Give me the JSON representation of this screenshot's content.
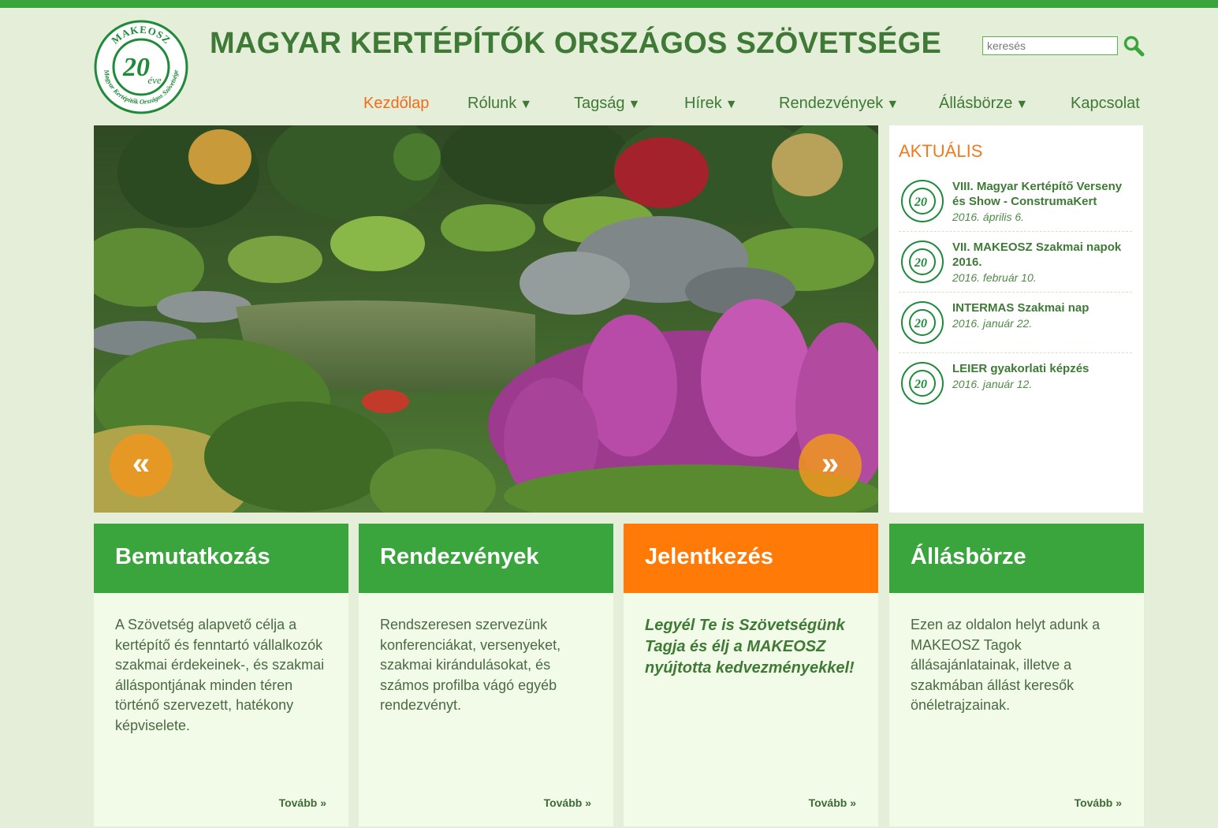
{
  "brand": {
    "logo_text_top": "MAKEOSZ",
    "logo_years": "20",
    "logo_eve": "éve",
    "logo_text_ring": "Magyar Kertépítők Országos Szövetsége",
    "title": "MAGYAR KERTÉPÍTŐK ORSZÁGOS SZÖVETSÉGE"
  },
  "search": {
    "placeholder": "keresés",
    "value": ""
  },
  "nav": {
    "items": [
      {
        "label": "Kezdőlap",
        "arrow": ""
      },
      {
        "label": "Rólunk",
        "arrow": "▼"
      },
      {
        "label": "Tagság",
        "arrow": "▼"
      },
      {
        "label": "Hírek",
        "arrow": "▼"
      },
      {
        "label": "Rendezvények",
        "arrow": "▼"
      },
      {
        "label": "Állásbörze",
        "arrow": "▼"
      },
      {
        "label": "Kapcsolat",
        "arrow": ""
      }
    ]
  },
  "slider": {
    "prev": "«",
    "next": "»"
  },
  "news": {
    "heading": "AKTUÁLIS",
    "items": [
      {
        "title": "VIII. Magyar Kertépítő Verseny és Show - ConstrumaKert",
        "date": "2016. április 6."
      },
      {
        "title": "VII. MAKEOSZ Szakmai napok 2016.",
        "date": "2016. február 10."
      },
      {
        "title": "INTERMAS Szakmai nap",
        "date": "2016. január 22."
      },
      {
        "title": "LEIER gyakorlati képzés",
        "date": "2016. január 12."
      }
    ]
  },
  "boxes": [
    {
      "title": "Bemutatkozás",
      "body": "A Szövetség alapvető célja a kertépítő és fenntartó vállalkozók szakmai érdekeinek-, és szakmai álláspontjának minden téren történő szervezett, hatékony képviselete.",
      "more": "Tovább »"
    },
    {
      "title": "Rendezvények",
      "body": "Rendszeresen szervezünk konferenciákat, versenyeket, szakmai kirándulásokat, és számos profilba vágó egyéb rendezvényt.",
      "more": "Tovább »"
    },
    {
      "title": "Jelentkezés",
      "body": "Legyél Te is Szövetségünk Tagja és élj a MAKEOSZ nyújtotta kedvezményekkel!",
      "more": "Tovább »"
    },
    {
      "title": "Állásbörze",
      "body": "Ezen az oldalon helyt adunk a MAKEOSZ Tagok állásajánlatainak, illetve a szakmában állást keresők önéletrajzainak.",
      "more": "Tovább »"
    }
  ],
  "colors": {
    "green": "#3aa53c",
    "dark_green": "#3e7a35",
    "orange": "#ff7a06",
    "active_nav": "#f26b1d",
    "page_bg": "#e4eed8"
  }
}
